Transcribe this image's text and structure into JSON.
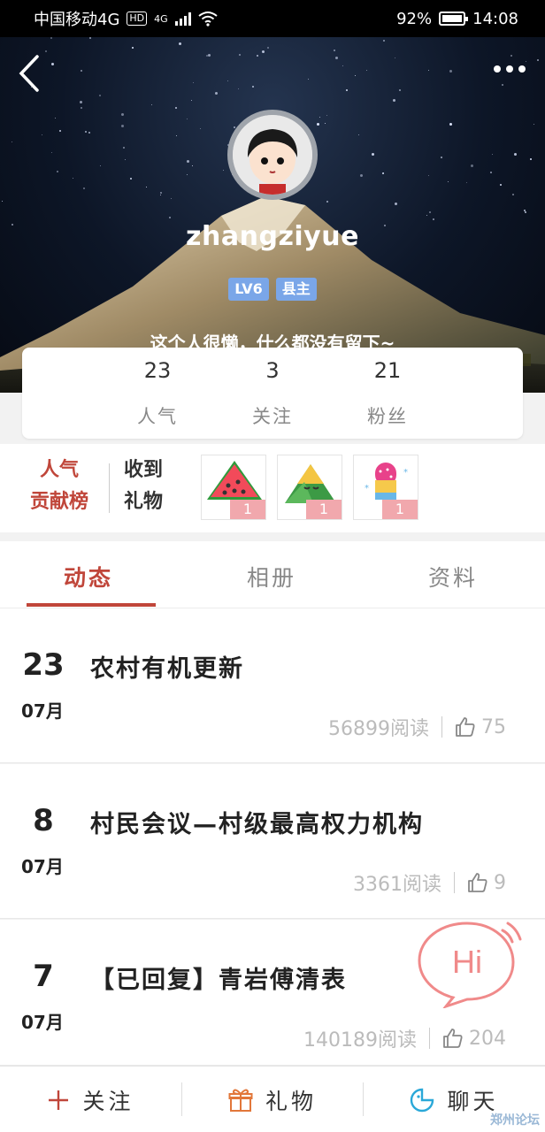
{
  "status_bar": {
    "carrier": "中国移动4G",
    "hd": "HD",
    "network": "4G",
    "battery": "92%",
    "time": "14:08"
  },
  "header": {
    "username": "zhangziyue",
    "level_badge": "LV6",
    "title_badge": "县主",
    "bio": "这个人很懒，什么都没有留下~"
  },
  "stats": [
    {
      "value": "23",
      "label": "人气"
    },
    {
      "value": "3",
      "label": "关注"
    },
    {
      "value": "21",
      "label": "粉丝"
    }
  ],
  "gifts": {
    "rank_label_line1": "人气",
    "rank_label_line2": "贡献榜",
    "received_line1": "收到",
    "received_line2": "礼物",
    "items": [
      {
        "icon": "watermelon-icon",
        "count": "1"
      },
      {
        "icon": "zongzi-icon",
        "count": "1"
      },
      {
        "icon": "popsicle-icon",
        "count": "1"
      }
    ]
  },
  "tabs": [
    {
      "label": "动态",
      "active": true
    },
    {
      "label": "相册",
      "active": false
    },
    {
      "label": "资料",
      "active": false
    }
  ],
  "feed": [
    {
      "day": "23",
      "month": "07月",
      "title": "农村有机更新",
      "reads": "56899阅读",
      "likes": "75"
    },
    {
      "day": "8",
      "month": "07月",
      "title": "村民会议—村级最高权力机构",
      "reads": "3361阅读",
      "likes": "9"
    },
    {
      "day": "7",
      "month": "07月",
      "title": "【已回复】青岩傅清表",
      "reads": "140189阅读",
      "likes": "204"
    }
  ],
  "hi_bubble": "Hi",
  "bottom_bar": {
    "follow": "关注",
    "gift": "礼物",
    "chat": "聊天"
  },
  "watermark": "郑州论坛",
  "colors": {
    "accent": "#c0463a",
    "badge": "#7aa6e8",
    "gift_count": "#f1a8ad"
  }
}
